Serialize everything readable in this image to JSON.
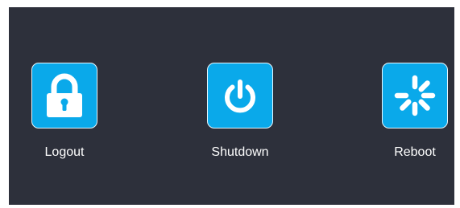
{
  "colors": {
    "background": "#2d303b",
    "button_fill": "#0aa9ea",
    "button_border": "#e6f6fd",
    "label": "#ffffff"
  },
  "actions": [
    {
      "label": "Logout",
      "icon": "lock-icon"
    },
    {
      "label": "Shutdown",
      "icon": "power-icon"
    },
    {
      "label": "Reboot",
      "icon": "loading-spinner-icon"
    }
  ]
}
